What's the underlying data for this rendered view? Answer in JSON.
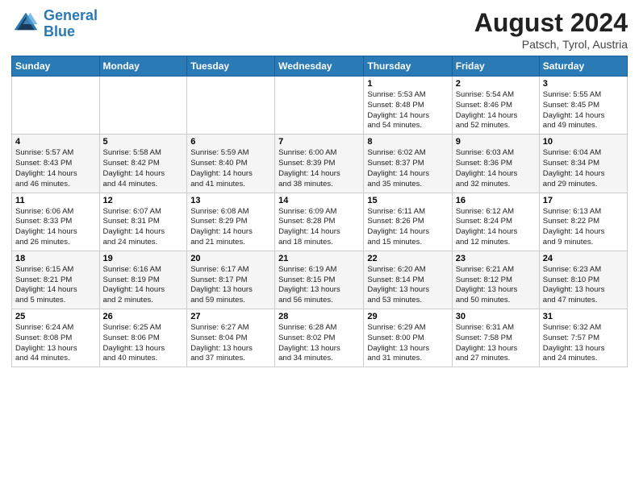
{
  "header": {
    "logo_line1": "General",
    "logo_line2": "Blue",
    "month": "August 2024",
    "location": "Patsch, Tyrol, Austria"
  },
  "days_of_week": [
    "Sunday",
    "Monday",
    "Tuesday",
    "Wednesday",
    "Thursday",
    "Friday",
    "Saturday"
  ],
  "weeks": [
    [
      {
        "day": "",
        "info": ""
      },
      {
        "day": "",
        "info": ""
      },
      {
        "day": "",
        "info": ""
      },
      {
        "day": "",
        "info": ""
      },
      {
        "day": "1",
        "info": "Sunrise: 5:53 AM\nSunset: 8:48 PM\nDaylight: 14 hours\nand 54 minutes."
      },
      {
        "day": "2",
        "info": "Sunrise: 5:54 AM\nSunset: 8:46 PM\nDaylight: 14 hours\nand 52 minutes."
      },
      {
        "day": "3",
        "info": "Sunrise: 5:55 AM\nSunset: 8:45 PM\nDaylight: 14 hours\nand 49 minutes."
      }
    ],
    [
      {
        "day": "4",
        "info": "Sunrise: 5:57 AM\nSunset: 8:43 PM\nDaylight: 14 hours\nand 46 minutes."
      },
      {
        "day": "5",
        "info": "Sunrise: 5:58 AM\nSunset: 8:42 PM\nDaylight: 14 hours\nand 44 minutes."
      },
      {
        "day": "6",
        "info": "Sunrise: 5:59 AM\nSunset: 8:40 PM\nDaylight: 14 hours\nand 41 minutes."
      },
      {
        "day": "7",
        "info": "Sunrise: 6:00 AM\nSunset: 8:39 PM\nDaylight: 14 hours\nand 38 minutes."
      },
      {
        "day": "8",
        "info": "Sunrise: 6:02 AM\nSunset: 8:37 PM\nDaylight: 14 hours\nand 35 minutes."
      },
      {
        "day": "9",
        "info": "Sunrise: 6:03 AM\nSunset: 8:36 PM\nDaylight: 14 hours\nand 32 minutes."
      },
      {
        "day": "10",
        "info": "Sunrise: 6:04 AM\nSunset: 8:34 PM\nDaylight: 14 hours\nand 29 minutes."
      }
    ],
    [
      {
        "day": "11",
        "info": "Sunrise: 6:06 AM\nSunset: 8:33 PM\nDaylight: 14 hours\nand 26 minutes."
      },
      {
        "day": "12",
        "info": "Sunrise: 6:07 AM\nSunset: 8:31 PM\nDaylight: 14 hours\nand 24 minutes."
      },
      {
        "day": "13",
        "info": "Sunrise: 6:08 AM\nSunset: 8:29 PM\nDaylight: 14 hours\nand 21 minutes."
      },
      {
        "day": "14",
        "info": "Sunrise: 6:09 AM\nSunset: 8:28 PM\nDaylight: 14 hours\nand 18 minutes."
      },
      {
        "day": "15",
        "info": "Sunrise: 6:11 AM\nSunset: 8:26 PM\nDaylight: 14 hours\nand 15 minutes."
      },
      {
        "day": "16",
        "info": "Sunrise: 6:12 AM\nSunset: 8:24 PM\nDaylight: 14 hours\nand 12 minutes."
      },
      {
        "day": "17",
        "info": "Sunrise: 6:13 AM\nSunset: 8:22 PM\nDaylight: 14 hours\nand 9 minutes."
      }
    ],
    [
      {
        "day": "18",
        "info": "Sunrise: 6:15 AM\nSunset: 8:21 PM\nDaylight: 14 hours\nand 5 minutes."
      },
      {
        "day": "19",
        "info": "Sunrise: 6:16 AM\nSunset: 8:19 PM\nDaylight: 14 hours\nand 2 minutes."
      },
      {
        "day": "20",
        "info": "Sunrise: 6:17 AM\nSunset: 8:17 PM\nDaylight: 13 hours\nand 59 minutes."
      },
      {
        "day": "21",
        "info": "Sunrise: 6:19 AM\nSunset: 8:15 PM\nDaylight: 13 hours\nand 56 minutes."
      },
      {
        "day": "22",
        "info": "Sunrise: 6:20 AM\nSunset: 8:14 PM\nDaylight: 13 hours\nand 53 minutes."
      },
      {
        "day": "23",
        "info": "Sunrise: 6:21 AM\nSunset: 8:12 PM\nDaylight: 13 hours\nand 50 minutes."
      },
      {
        "day": "24",
        "info": "Sunrise: 6:23 AM\nSunset: 8:10 PM\nDaylight: 13 hours\nand 47 minutes."
      }
    ],
    [
      {
        "day": "25",
        "info": "Sunrise: 6:24 AM\nSunset: 8:08 PM\nDaylight: 13 hours\nand 44 minutes."
      },
      {
        "day": "26",
        "info": "Sunrise: 6:25 AM\nSunset: 8:06 PM\nDaylight: 13 hours\nand 40 minutes."
      },
      {
        "day": "27",
        "info": "Sunrise: 6:27 AM\nSunset: 8:04 PM\nDaylight: 13 hours\nand 37 minutes."
      },
      {
        "day": "28",
        "info": "Sunrise: 6:28 AM\nSunset: 8:02 PM\nDaylight: 13 hours\nand 34 minutes."
      },
      {
        "day": "29",
        "info": "Sunrise: 6:29 AM\nSunset: 8:00 PM\nDaylight: 13 hours\nand 31 minutes."
      },
      {
        "day": "30",
        "info": "Sunrise: 6:31 AM\nSunset: 7:58 PM\nDaylight: 13 hours\nand 27 minutes."
      },
      {
        "day": "31",
        "info": "Sunrise: 6:32 AM\nSunset: 7:57 PM\nDaylight: 13 hours\nand 24 minutes."
      }
    ]
  ]
}
